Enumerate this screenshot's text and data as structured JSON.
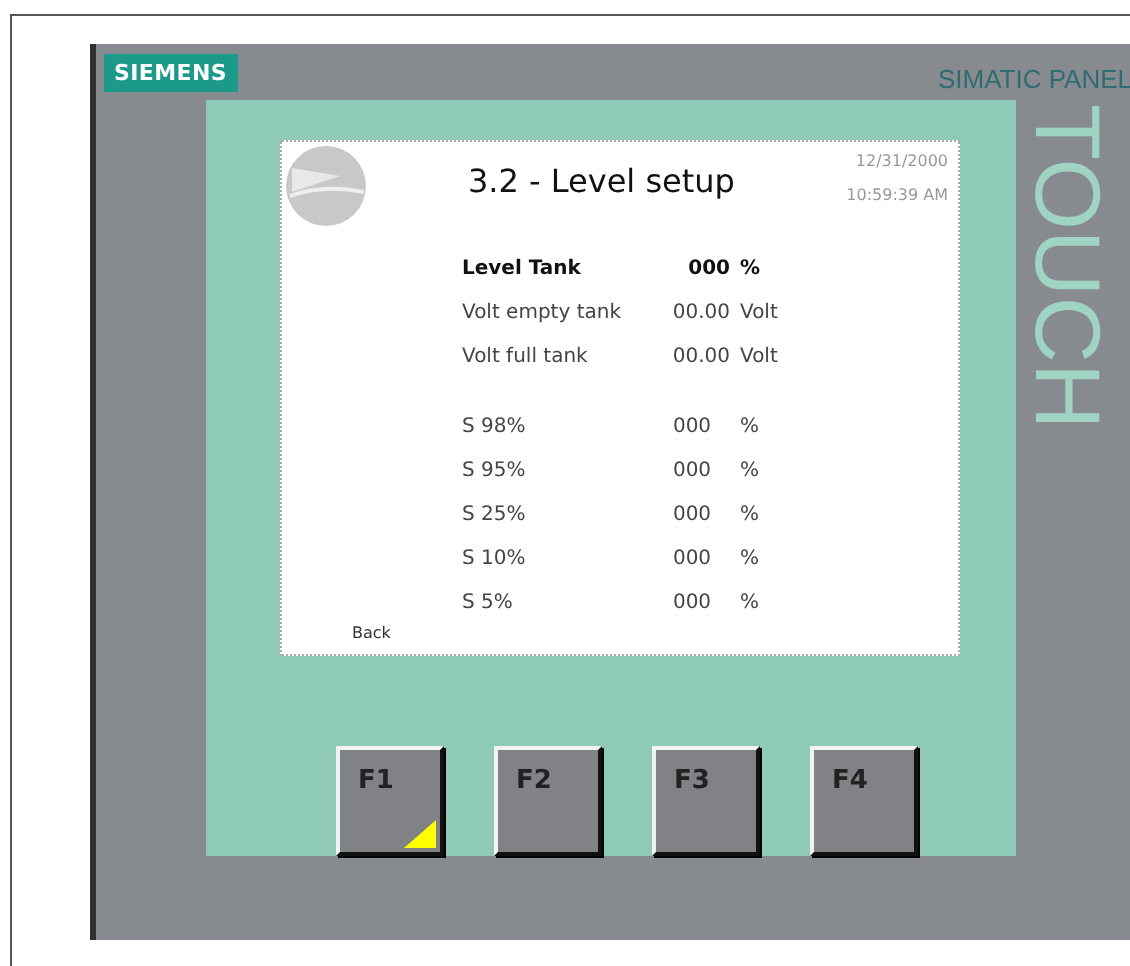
{
  "panel": {
    "brand": "SIEMENS",
    "model": "SIMATIC PANEL",
    "touch_label": "TOUCH"
  },
  "screen": {
    "title": "3.2 - Level setup",
    "date": "12/31/2000",
    "time": "10:59:39 AM",
    "measurements": [
      {
        "kind": "primary",
        "label": "Level Tank",
        "value": "000",
        "unit": "%"
      },
      {
        "kind": "plain",
        "label": "Volt empty tank",
        "value": "00.00",
        "unit": "Volt"
      },
      {
        "kind": "plain",
        "label": "Volt full tank",
        "value": "00.00",
        "unit": "Volt"
      }
    ],
    "setpoints": [
      {
        "label": "S 98%",
        "value": "000",
        "unit": "%"
      },
      {
        "label": "S 95%",
        "value": "000",
        "unit": "%"
      },
      {
        "label": "S 25%",
        "value": "000",
        "unit": "%"
      },
      {
        "label": "S 10%",
        "value": "000",
        "unit": "%"
      },
      {
        "label": "S 5%",
        "value": "000",
        "unit": "%"
      }
    ],
    "back": "Back"
  },
  "function_keys": [
    {
      "label": "F1",
      "led": true
    },
    {
      "label": "F2",
      "led": false
    },
    {
      "label": "F3",
      "led": false
    },
    {
      "label": "F4",
      "led": false
    }
  ]
}
